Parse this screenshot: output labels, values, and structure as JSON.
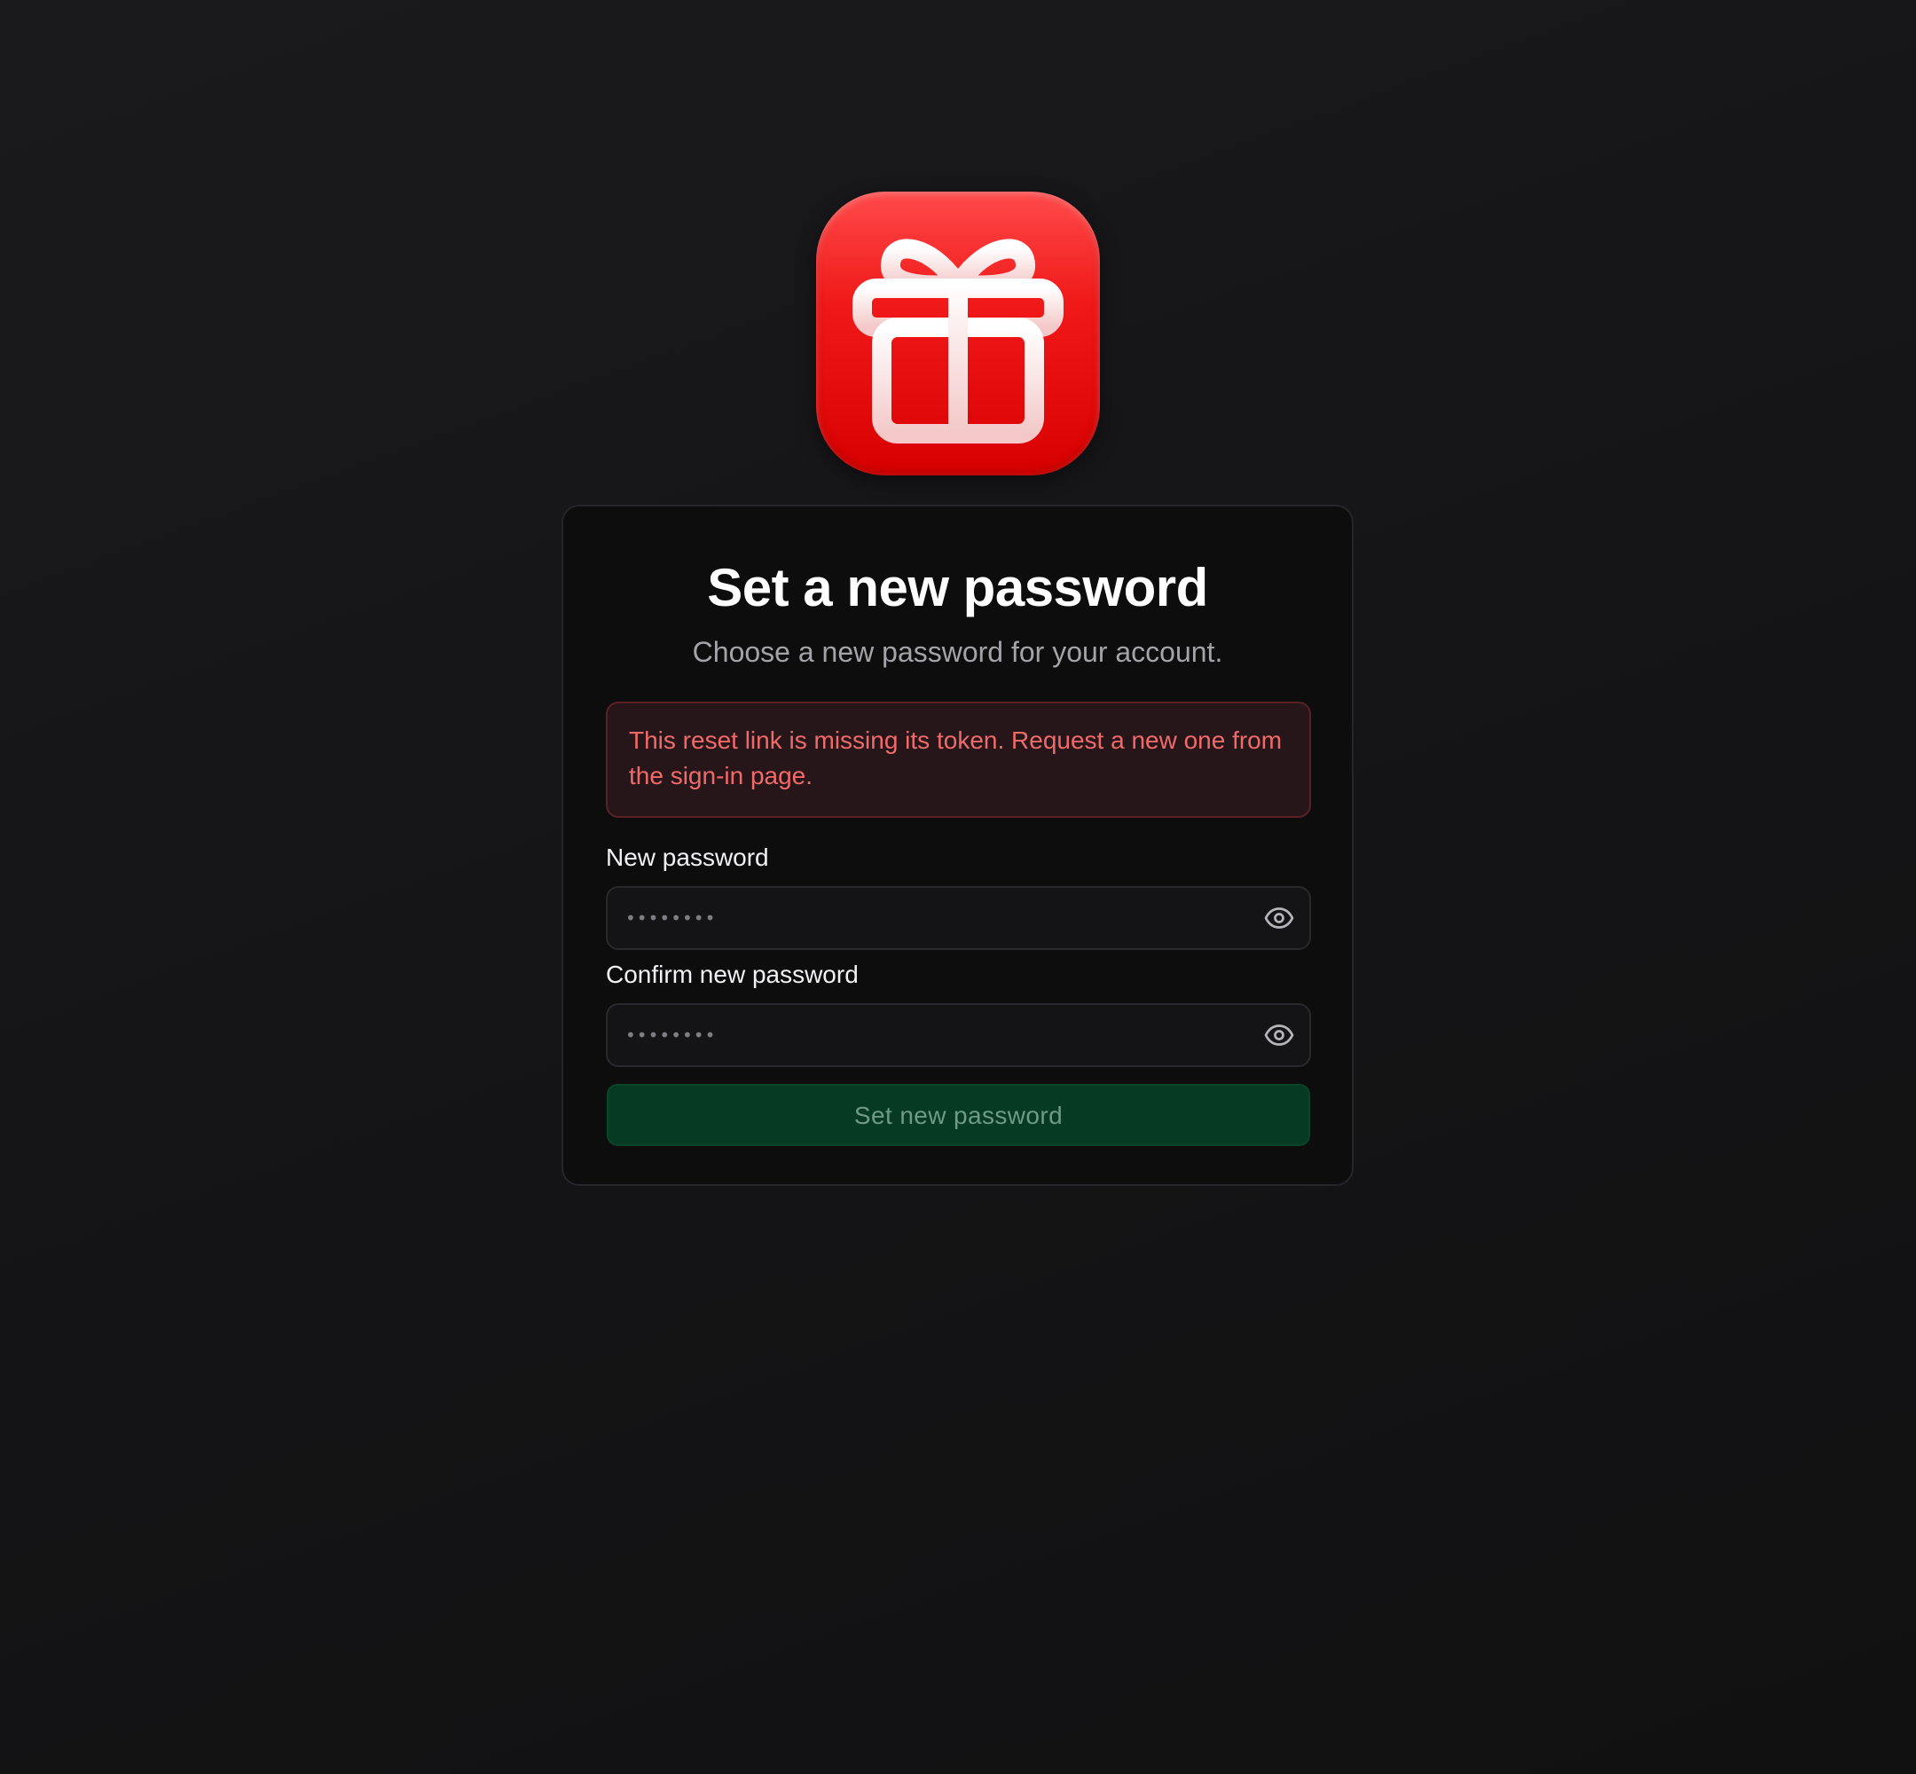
{
  "app": {
    "icon_name": "gift-icon",
    "icon_color": "#e80808"
  },
  "card": {
    "title": "Set a new password",
    "subtitle": "Choose a new password for your account."
  },
  "error": {
    "message": "This reset link is missing its token. Request a new one from the sign-in page.",
    "color": "#f16a6a"
  },
  "fields": {
    "new_password": {
      "label": "New password",
      "placeholder": "••••••••",
      "toggle_icon": "eye-icon"
    },
    "confirm_password": {
      "label": "Confirm new password",
      "placeholder": "••••••••",
      "toggle_icon": "eye-icon"
    }
  },
  "submit": {
    "label": "Set new password",
    "background": "#063a22"
  }
}
